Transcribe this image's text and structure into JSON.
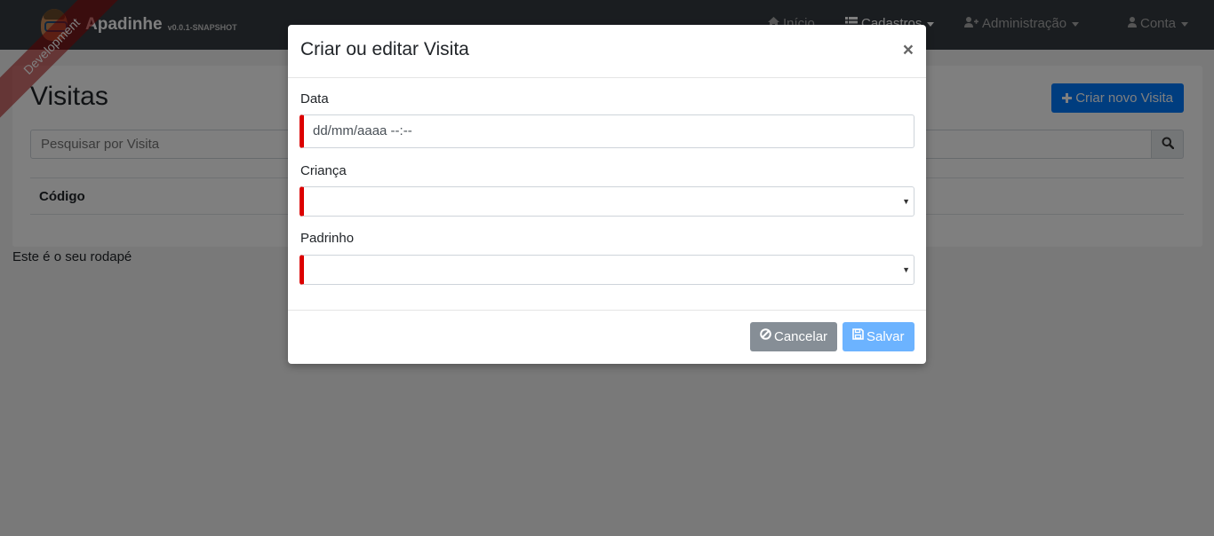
{
  "navbar": {
    "brand_name": "Apadinhe",
    "brand_version": "v0.0.1-SNAPSHOT",
    "ribbon": "Development",
    "items": [
      {
        "label": "Início",
        "icon": "home-icon"
      },
      {
        "label": "Cadastros",
        "icon": "th-list-icon"
      },
      {
        "label": "Administração",
        "icon": "user-plus-icon"
      },
      {
        "label": "Conta",
        "icon": "user-icon"
      }
    ]
  },
  "page": {
    "title": "Visitas",
    "create_button": "Criar novo Visita",
    "search_placeholder": "Pesquisar por Visita",
    "table_headers": [
      "Código"
    ],
    "footer": "Este é o seu rodapé"
  },
  "modal": {
    "title": "Criar ou editar Visita",
    "close": "×",
    "fields": [
      {
        "label": "Data",
        "value": "dd/mm/aaaa --:--"
      },
      {
        "label": "Criança",
        "value": ""
      },
      {
        "label": "Padrinho",
        "value": ""
      }
    ],
    "cancel_label": "Cancelar",
    "save_label": "Salvar"
  },
  "colors": {
    "navbar": "#343a40",
    "primary": "#007bff",
    "secondary": "#868e96",
    "required_marker": "#dc0000"
  }
}
